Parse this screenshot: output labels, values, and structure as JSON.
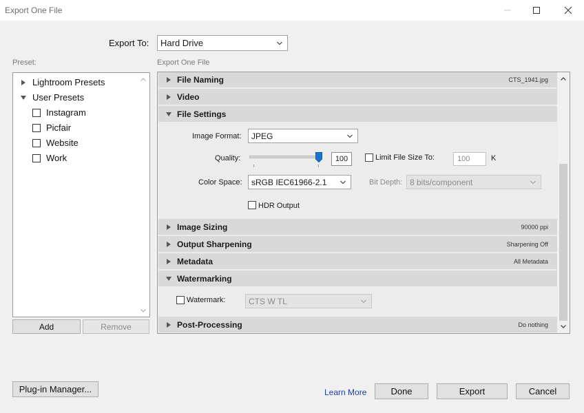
{
  "window": {
    "title": "Export One File"
  },
  "export_to": {
    "label": "Export To:",
    "value": "Hard Drive"
  },
  "preset": {
    "label": "Preset:",
    "groups": [
      {
        "label": "Lightroom Presets",
        "expanded": false
      },
      {
        "label": "User Presets",
        "expanded": true
      }
    ],
    "items": [
      {
        "label": "Instagram",
        "checked": false
      },
      {
        "label": "Picfair",
        "checked": false
      },
      {
        "label": "Website",
        "checked": false
      },
      {
        "label": "Work",
        "checked": false
      }
    ],
    "add_label": "Add",
    "remove_label": "Remove"
  },
  "panel": {
    "label": "Export One File",
    "sections": {
      "file_naming": {
        "title": "File Naming",
        "summary": "CTS_1941.jpg",
        "expanded": false
      },
      "video": {
        "title": "Video",
        "summary": "",
        "expanded": false
      },
      "file_settings": {
        "title": "File Settings",
        "expanded": true
      },
      "image_sizing": {
        "title": "Image Sizing",
        "summary": "90000 ppi",
        "expanded": false
      },
      "output_sharpening": {
        "title": "Output Sharpening",
        "summary": "Sharpening Off",
        "expanded": false
      },
      "metadata": {
        "title": "Metadata",
        "summary": "All Metadata",
        "expanded": false
      },
      "watermarking": {
        "title": "Watermarking",
        "expanded": true
      },
      "post_processing": {
        "title": "Post-Processing",
        "summary": "Do nothing",
        "expanded": false
      }
    },
    "file_settings": {
      "image_format_label": "Image Format:",
      "image_format_value": "JPEG",
      "quality_label": "Quality:",
      "quality_value": "100",
      "quality_fraction": 1.0,
      "limit_label": "Limit File Size To:",
      "limit_checked": false,
      "limit_value": "100",
      "limit_unit": "K",
      "color_space_label": "Color Space:",
      "color_space_value": "sRGB IEC61966-2.1",
      "bit_depth_label": "Bit Depth:",
      "bit_depth_value": "8 bits/component",
      "hdr_label": "HDR Output",
      "hdr_checked": false
    },
    "watermarking": {
      "watermark_label": "Watermark:",
      "watermark_checked": false,
      "watermark_value": "CTS W TL"
    }
  },
  "footer": {
    "plugin_manager_label": "Plug-in Manager...",
    "learn_more_label": "Learn More",
    "done_label": "Done",
    "export_label": "Export",
    "cancel_label": "Cancel"
  },
  "colors": {
    "slider_thumb": "#1a73c9",
    "link": "#1c3fa8",
    "section_header": "#d9d9d9"
  }
}
